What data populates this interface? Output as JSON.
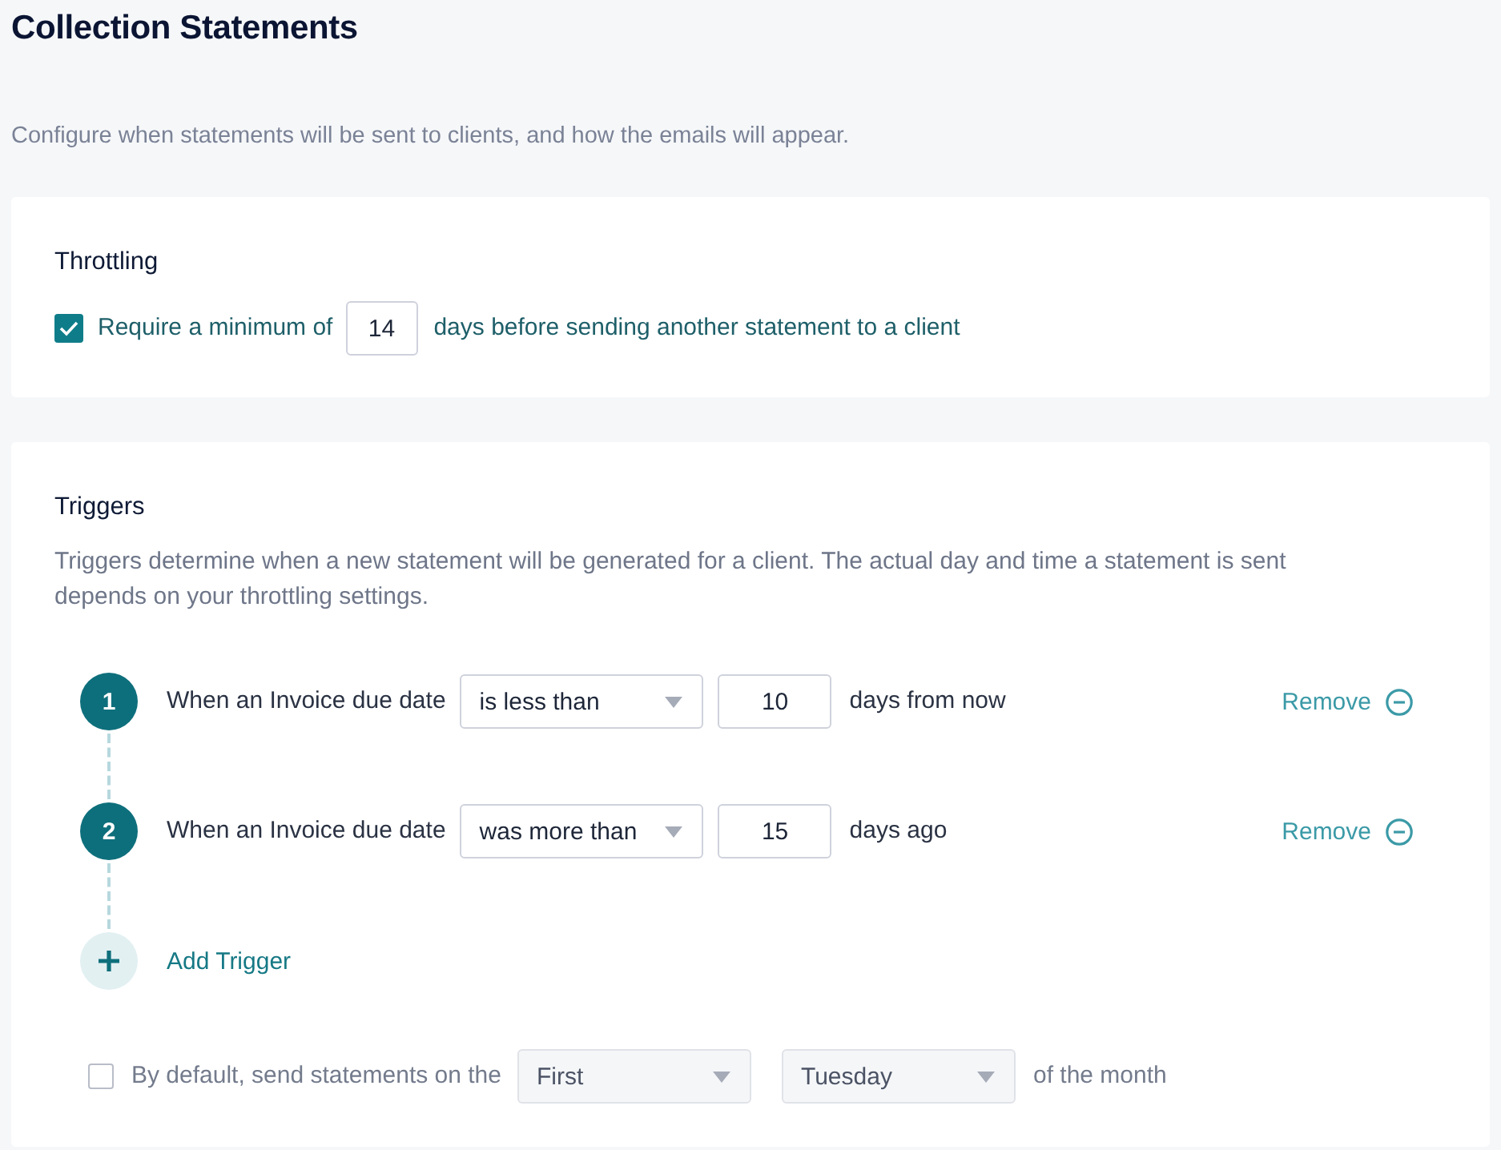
{
  "page": {
    "title": "Collection Statements",
    "description": "Configure when statements will be sent to clients, and how the emails will appear."
  },
  "throttling": {
    "title": "Throttling",
    "checked": true,
    "label_before": "Require a minimum of",
    "days": "14",
    "label_after": "days before sending another statement to a client"
  },
  "triggers": {
    "title": "Triggers",
    "description": "Triggers determine when a new statement will be generated for a client. The actual day and time a statement is sent depends on your throttling settings.",
    "items": [
      {
        "number": "1",
        "prefix": "When an Invoice due date",
        "condition": "is less than",
        "days": "10",
        "suffix": "days from now",
        "remove_label": "Remove"
      },
      {
        "number": "2",
        "prefix": "When an Invoice due date",
        "condition": "was more than",
        "days": "15",
        "suffix": "days ago",
        "remove_label": "Remove"
      }
    ],
    "add_label": "Add Trigger"
  },
  "default_schedule": {
    "checked": false,
    "label_before": "By default, send statements on the",
    "ordinal": "First",
    "weekday": "Tuesday",
    "label_after": "of the month"
  }
}
